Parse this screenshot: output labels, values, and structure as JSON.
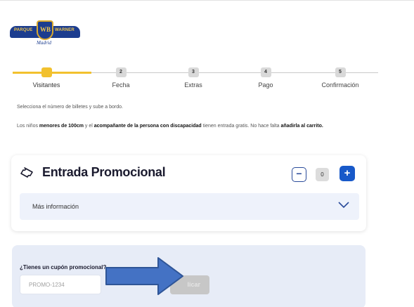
{
  "header": {
    "logo_text_left": "PARQUE",
    "logo_text_right": "WARNER",
    "logo_shield": "WB",
    "logo_sub": "Madrid"
  },
  "stepper": {
    "steps": [
      {
        "number": "1",
        "label": "Visitantes",
        "active": true
      },
      {
        "number": "2",
        "label": "Fecha",
        "active": false
      },
      {
        "number": "3",
        "label": "Extras",
        "active": false
      },
      {
        "number": "4",
        "label": "Pago",
        "active": false
      },
      {
        "number": "5",
        "label": "Confirmación",
        "active": false
      }
    ],
    "colors": {
      "active": "#f2c12e",
      "inactive": "#d9d9d9"
    }
  },
  "intro_text": "Selecciona el número de billetes y sube a bordo.",
  "note": {
    "part1": "Los niños ",
    "bold1": "menores de 100cm",
    "part2": " y el ",
    "bold2": "acompañante de la persona con discapacidad",
    "part3": " tienen entrada gratis. No hace falta ",
    "bold3": "añadirla al carrito."
  },
  "ticket": {
    "icon": "ticket-icon",
    "title": "Entrada Promocional",
    "minus_label": "−",
    "quantity": "0",
    "plus_label": "+",
    "more_info": "Más información",
    "accent_color": "#1859c9"
  },
  "coupon": {
    "title": "¿Tienes un cupón promocional?",
    "placeholder": "PROMO-1234",
    "apply_label": "licar"
  },
  "annotation": {
    "icon": "arrow-right-icon",
    "color": "#4472c4"
  }
}
